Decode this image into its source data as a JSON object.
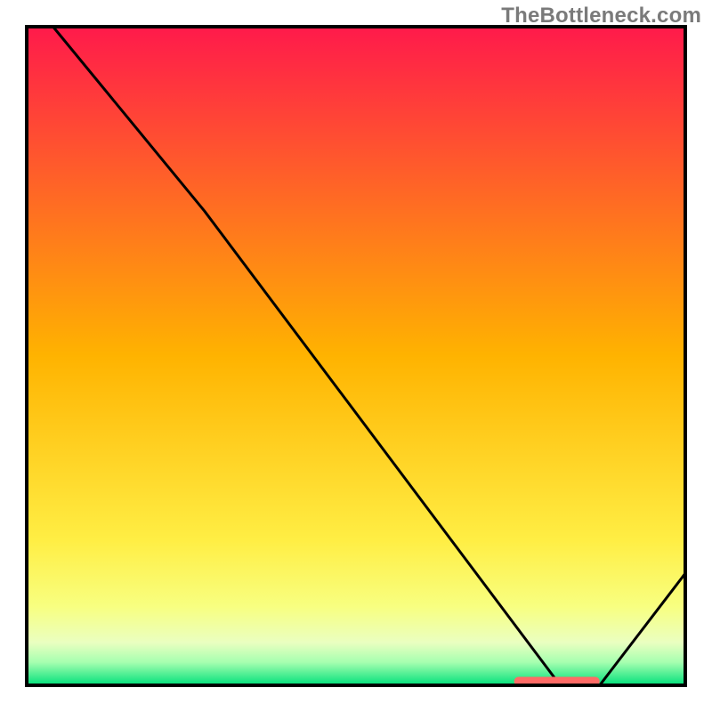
{
  "watermark": "TheBottleneck.com",
  "chart_data": {
    "type": "line",
    "title": "",
    "xlabel": "",
    "ylabel": "",
    "xlim": [
      0,
      100
    ],
    "ylim": [
      0,
      100
    ],
    "background_gradient": {
      "stops": [
        {
          "offset": 0.0,
          "color": "#ff1a4b"
        },
        {
          "offset": 0.5,
          "color": "#ffb300"
        },
        {
          "offset": 0.78,
          "color": "#ffee44"
        },
        {
          "offset": 0.88,
          "color": "#f8ff80"
        },
        {
          "offset": 0.935,
          "color": "#eaffc0"
        },
        {
          "offset": 0.965,
          "color": "#a6ffb0"
        },
        {
          "offset": 1.0,
          "color": "#00e07a"
        }
      ]
    },
    "series": [
      {
        "name": "curve",
        "x": [
          4,
          27,
          81,
          87,
          100
        ],
        "y": [
          100,
          72,
          0,
          0,
          17
        ]
      }
    ],
    "marker_bar": {
      "x_start": 74,
      "x_end": 87,
      "y": 0.6,
      "color": "#ff6b66"
    }
  }
}
